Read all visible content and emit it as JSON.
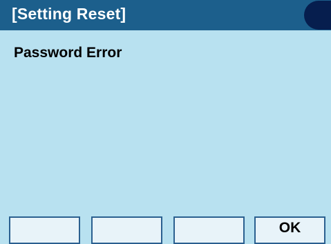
{
  "header": {
    "title": "[Setting Reset]"
  },
  "main": {
    "message": "Password Error"
  },
  "softkeys": [
    {
      "label": ""
    },
    {
      "label": ""
    },
    {
      "label": ""
    },
    {
      "label": "OK"
    }
  ],
  "colors": {
    "background": "#b8e1f0",
    "titlebar": "#1c5f8c",
    "status_indicator": "#061e4e",
    "softkey_fill": "#e8f3f9",
    "softkey_border": "#2a5f8f"
  }
}
